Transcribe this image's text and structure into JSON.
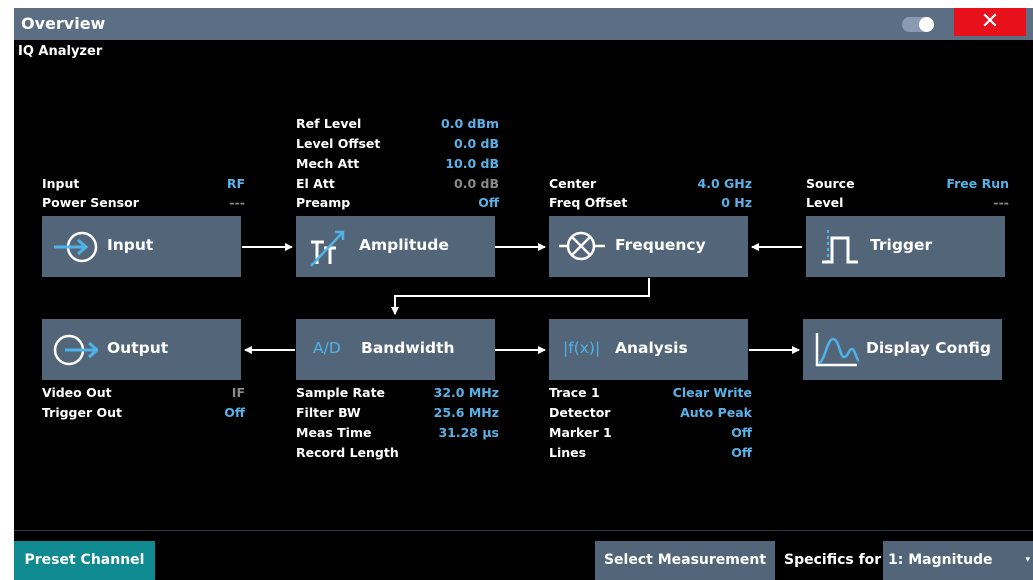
{
  "window": {
    "title": "Overview",
    "subtitle": "IQ Analyzer",
    "close_label": "✕"
  },
  "colors": {
    "titlebar": "#5b6e84",
    "block": "#536679",
    "value_blue": "#58b2e8",
    "value_gray": "#8a8a8a",
    "close_red": "#e8101a",
    "preset_teal": "#0f8a90"
  },
  "blocks": {
    "input": {
      "label": "Input",
      "icon": "arrow-into-circle-icon"
    },
    "amplitude": {
      "label": "Amplitude",
      "icon": "attenuator-icon"
    },
    "frequency": {
      "label": "Frequency",
      "icon": "mixer-icon"
    },
    "trigger": {
      "label": "Trigger",
      "icon": "pulse-icon"
    },
    "output": {
      "label": "Output",
      "icon": "arrow-out-circle-icon"
    },
    "bandwidth": {
      "label": "Bandwidth",
      "icon_text": "A/D"
    },
    "analysis": {
      "label": "Analysis",
      "icon_text": "|f(x)|"
    },
    "display": {
      "label": "Display Config",
      "icon": "waveform-icon"
    }
  },
  "input_info": [
    {
      "key": "Input",
      "value": "RF"
    },
    {
      "key": "Power Sensor",
      "value": "---"
    }
  ],
  "amplitude_info": [
    {
      "key": "Ref Level",
      "value": "0.0 dBm"
    },
    {
      "key": "Level Offset",
      "value": "0.0 dB"
    },
    {
      "key": "Mech Att",
      "value": "10.0 dB"
    },
    {
      "key": "El Att",
      "value": "0.0 dB"
    },
    {
      "key": "Preamp",
      "value": "Off"
    }
  ],
  "frequency_info": [
    {
      "key": "Center",
      "value": "4.0 GHz"
    },
    {
      "key": "Freq Offset",
      "value": "0 Hz"
    }
  ],
  "trigger_info": [
    {
      "key": "Source",
      "value": "Free Run"
    },
    {
      "key": "Level",
      "value": "---"
    }
  ],
  "output_info": [
    {
      "key": "Video Out",
      "value": "IF"
    },
    {
      "key": "Trigger Out",
      "value": "Off"
    }
  ],
  "bandwidth_info": [
    {
      "key": "Sample Rate",
      "value": "32.0 MHz"
    },
    {
      "key": "Filter BW",
      "value": "25.6 MHz"
    },
    {
      "key": "Meas Time",
      "value": "31.28 µs"
    },
    {
      "key": "Record Length",
      "value": ""
    }
  ],
  "analysis_info": [
    {
      "key": "Trace 1",
      "value": "Clear Write"
    },
    {
      "key": "Detector",
      "value": "Auto Peak"
    },
    {
      "key": "Marker 1",
      "value": "Off"
    },
    {
      "key": "Lines",
      "value": "Off"
    }
  ],
  "bottom": {
    "preset_label": "Preset Channel",
    "select_label": "Select Measurement",
    "specifics_label": "Specifics for",
    "specifics_value": "1: Magnitude",
    "caret": "▾"
  }
}
